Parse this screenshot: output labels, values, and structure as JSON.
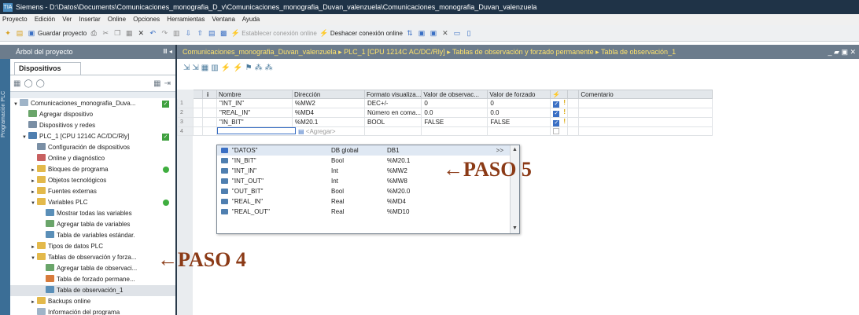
{
  "window": {
    "app_title": "Siemens  -  D:\\Datos\\Documents\\Comunicaciones_monografia_D_v\\Comunicaciones_monografia_Duvan_valenzuela\\Comunicaciones_monografia_Duvan_valenzuela",
    "logo_text": "TIA"
  },
  "menu": [
    "Proyecto",
    "Edición",
    "Ver",
    "Insertar",
    "Online",
    "Opciones",
    "Herramientas",
    "Ventana",
    "Ayuda"
  ],
  "toolbar": {
    "save_label": "Guardar proyecto",
    "connect_online_label": "Establecer conexión online",
    "disconnect_online_label": "Deshacer conexión online"
  },
  "left_panel": {
    "header": "Árbol del proyecto",
    "tab": "Dispositivos",
    "side_label": "Programación PLC",
    "tree": [
      {
        "label": "Comunicaciones_monografia_Duva...",
        "arrow": "▼",
        "icon": "doc",
        "badge": "check",
        "indent": 0
      },
      {
        "label": "Agregar dispositivo",
        "arrow": "",
        "icon": "add",
        "badge": "",
        "indent": 1
      },
      {
        "label": "Dispositivos y redes",
        "arrow": "",
        "icon": "cfg",
        "badge": "",
        "indent": 1
      },
      {
        "label": "PLC_1 [CPU 1214C AC/DC/Rly]",
        "arrow": "▼",
        "icon": "plc",
        "badge": "check",
        "indent": 1
      },
      {
        "label": "Configuración de dispositivos",
        "arrow": "",
        "icon": "cfg",
        "badge": "",
        "indent": 2
      },
      {
        "label": "Online y diagnóstico",
        "arrow": "",
        "icon": "diag",
        "badge": "",
        "indent": 2
      },
      {
        "label": "Bloques de programa",
        "arrow": "►",
        "icon": "folder",
        "badge": "status",
        "indent": 2
      },
      {
        "label": "Objetos tecnológicos",
        "arrow": "►",
        "icon": "folder",
        "badge": "",
        "indent": 2
      },
      {
        "label": "Fuentes externas",
        "arrow": "►",
        "icon": "folder",
        "badge": "",
        "indent": 2
      },
      {
        "label": "Variables PLC",
        "arrow": "▼",
        "icon": "folder",
        "badge": "status",
        "indent": 2
      },
      {
        "label": "Mostrar todas las variables",
        "arrow": "",
        "icon": "table",
        "badge": "",
        "indent": 3
      },
      {
        "label": "Agregar tabla de variables",
        "arrow": "",
        "icon": "add",
        "badge": "",
        "indent": 3
      },
      {
        "label": "Tabla de variables estándar.",
        "arrow": "",
        "icon": "table",
        "badge": "",
        "indent": 3
      },
      {
        "label": "Tipos de datos PLC",
        "arrow": "►",
        "icon": "folder",
        "badge": "",
        "indent": 2
      },
      {
        "label": "Tablas de observación y forza...",
        "arrow": "▼",
        "icon": "folder",
        "badge": "",
        "indent": 2
      },
      {
        "label": "Agregar tabla de observaci...",
        "arrow": "",
        "icon": "add",
        "badge": "",
        "indent": 3
      },
      {
        "label": "Tabla de forzado permane...",
        "arrow": "",
        "icon": "force",
        "badge": "",
        "indent": 3
      },
      {
        "label": "Tabla de observación_1",
        "arrow": "",
        "icon": "table",
        "badge": "",
        "indent": 3,
        "selected": true
      },
      {
        "label": "Backups online",
        "arrow": "►",
        "icon": "folder",
        "badge": "",
        "indent": 2
      },
      {
        "label": "Información del programa",
        "arrow": "",
        "icon": "doc",
        "badge": "",
        "indent": 2
      }
    ]
  },
  "editor": {
    "breadcrumb": "Comunicaciones_monografia_Duvan_valenzuela  ▸  PLC_1 [CPU 1214C AC/DC/Rly]  ▸  Tablas de observación y forzado permanente  ▸  Tabla de observación_1",
    "window_controls": "_ ▰ ▣ ✕",
    "columns": {
      "info": "i",
      "name": "Nombre",
      "address": "Dirección",
      "format": "Formato visualiza...",
      "observe": "Valor de observac...",
      "force": "Valor de forzado",
      "flag": "⚡",
      "comment": "Comentario"
    },
    "rows": [
      {
        "idx": "1",
        "name": "\"INT_IN\"",
        "address": "%MW2",
        "format": "DEC+/-",
        "observe": "0",
        "force": "0"
      },
      {
        "idx": "2",
        "name": "\"REAL_IN\"",
        "address": "%MD4",
        "format": "Número en coma...",
        "observe": "0.0",
        "force": "0.0"
      },
      {
        "idx": "3",
        "name": "\"IN_BIT\"",
        "address": "%M20.1",
        "format": "BOOL",
        "observe": "FALSE",
        "force": "FALSE"
      }
    ],
    "new_row": {
      "idx": "4",
      "add_label": "<Agregar>"
    }
  },
  "popup": {
    "more": ">>",
    "items": [
      {
        "name": "\"DATOS\"",
        "type": "DB global",
        "addr": "DB1"
      },
      {
        "name": "\"IN_BIT\"",
        "type": "Bool",
        "addr": "%M20.1"
      },
      {
        "name": "\"INT_IN\"",
        "type": "Int",
        "addr": "%MW2"
      },
      {
        "name": "\"INT_OUT\"",
        "type": "Int",
        "addr": "%MW8"
      },
      {
        "name": "\"OUT_BIT\"",
        "type": "Bool",
        "addr": "%M20.0"
      },
      {
        "name": "\"REAL_IN\"",
        "type": "Real",
        "addr": "%MD4"
      },
      {
        "name": "\"REAL_OUT\"",
        "type": "Real",
        "addr": "%MD10"
      }
    ]
  },
  "annotations": {
    "paso4": "←PASO 4",
    "paso5": "←PASO 5"
  }
}
